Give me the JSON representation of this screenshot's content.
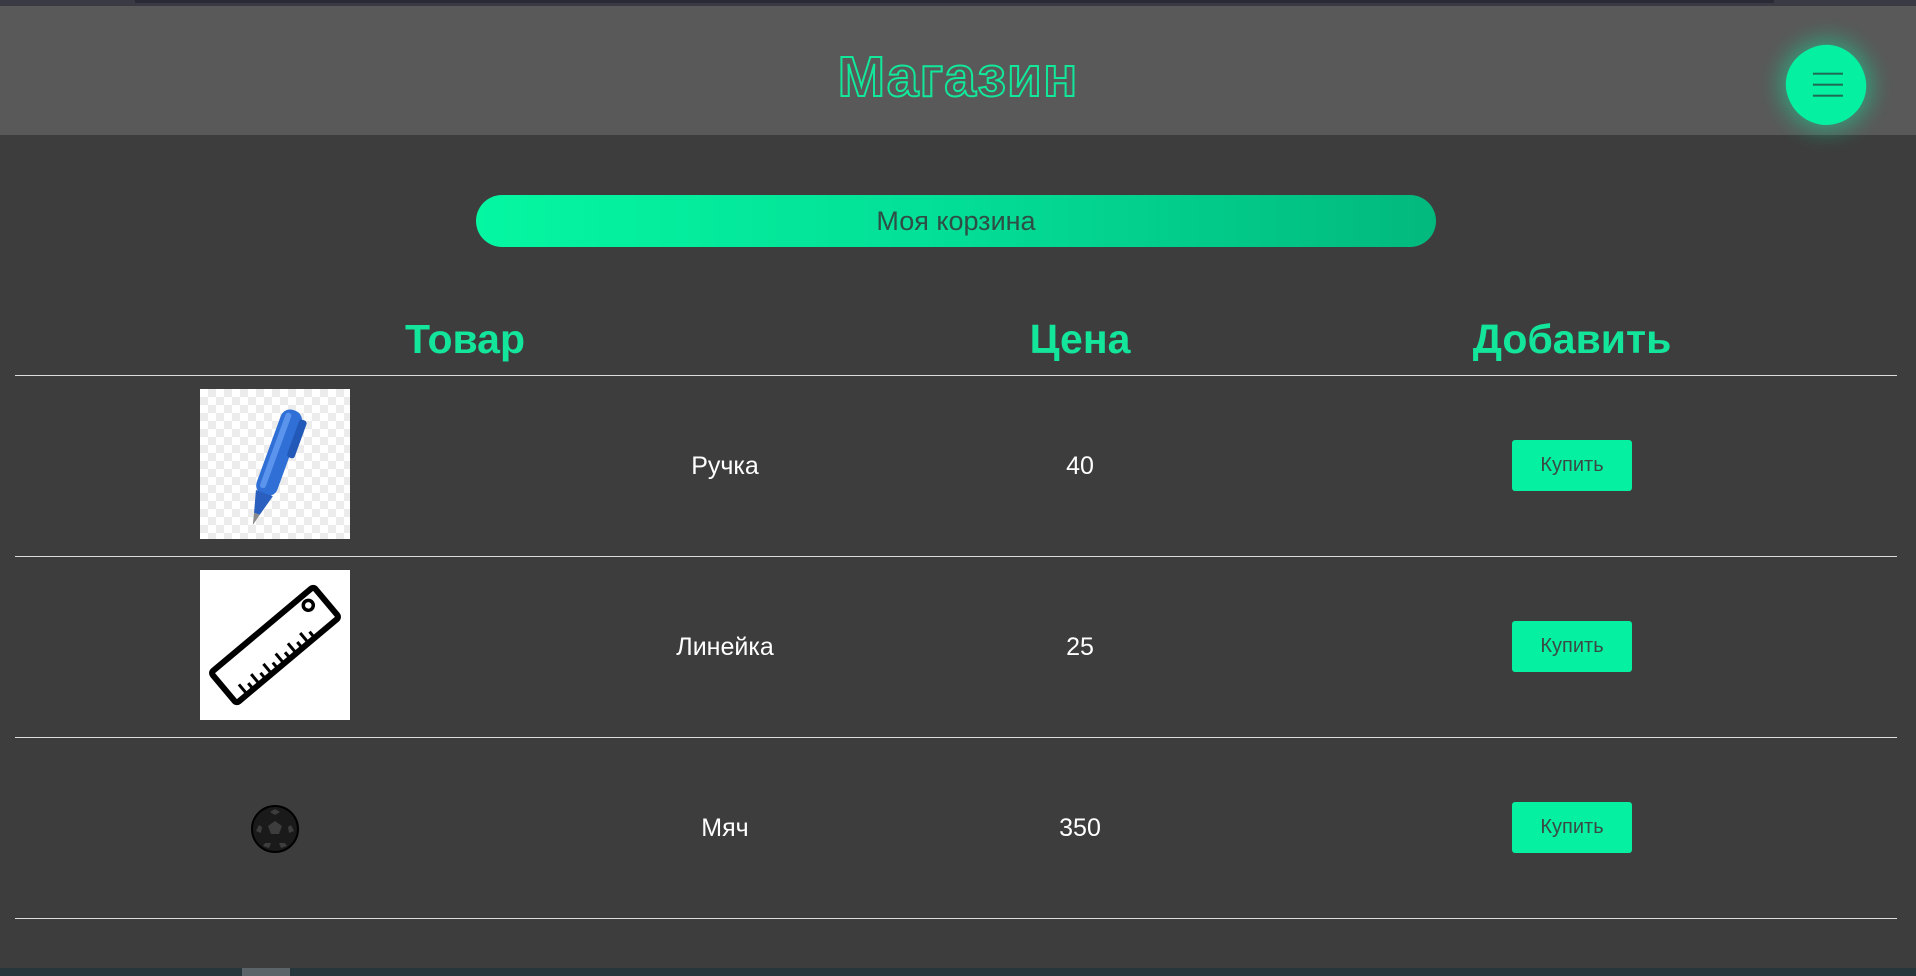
{
  "header": {
    "title": "Магазин",
    "menu_icon": "hamburger-menu-icon"
  },
  "cart": {
    "label": "Моя корзина"
  },
  "table": {
    "columns": [
      "Товар",
      "Цена",
      "Добавить"
    ],
    "rows": [
      {
        "image_icon": "pen-icon",
        "name": "Ручка",
        "price": "40",
        "action": "Купить"
      },
      {
        "image_icon": "ruler-icon",
        "name": "Линейка",
        "price": "25",
        "action": "Купить"
      },
      {
        "image_icon": "soccer-ball-icon",
        "name": "Мяч",
        "price": "350",
        "action": "Купить"
      }
    ]
  },
  "colors": {
    "accent": "#05f0a0",
    "background": "#3d3d3d",
    "header_bg": "#595959",
    "heading_text": "#13e59b"
  }
}
